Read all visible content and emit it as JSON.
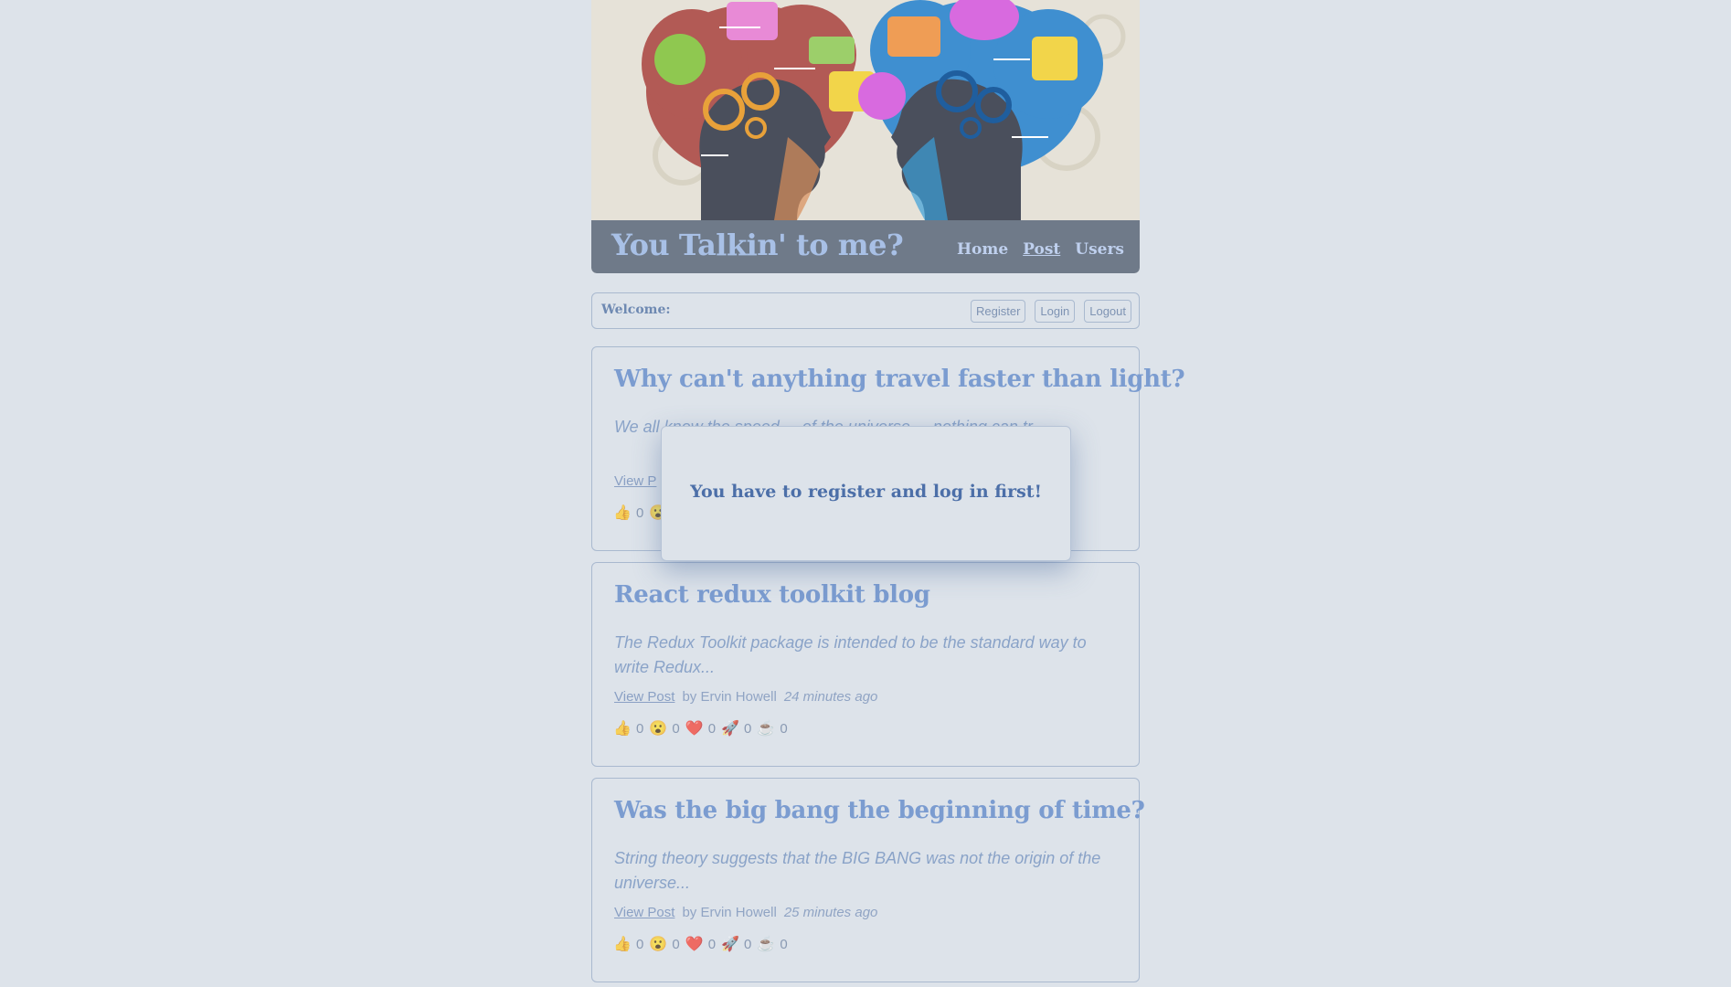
{
  "header": {
    "site_title": "You Talkin' to me?",
    "nav": [
      {
        "label": "Home",
        "active": false
      },
      {
        "label": "Post",
        "active": true
      },
      {
        "label": "Users",
        "active": false
      }
    ]
  },
  "welcome_bar": {
    "label": "Welcome:",
    "register_label": "Register",
    "login_label": "Login",
    "logout_label": "Logout"
  },
  "posts": [
    {
      "title": "Why can't anything travel faster than light?",
      "excerpt": "We all know the speed ... of the universe ... nothing can tr...",
      "view_label": "View P",
      "author": "",
      "time": "",
      "reactions": [
        "0"
      ]
    },
    {
      "title": "React redux toolkit blog",
      "excerpt": "The Redux Toolkit package is intended to be the standard way to write Redux...",
      "view_label": "View Post",
      "author": "by Ervin Howell",
      "time": "24 minutes ago",
      "reactions": [
        "0",
        "0",
        "0",
        "0",
        "0"
      ]
    },
    {
      "title": "Was the big bang the beginning of time?",
      "excerpt": "String theory suggests that the BIG BANG was not the origin of the universe...",
      "view_label": "View Post",
      "author": "by Ervin Howell",
      "time": "25 minutes ago",
      "reactions": [
        "0",
        "0",
        "0",
        "0",
        "0"
      ]
    }
  ],
  "reaction_icons": [
    "thumbs-up-icon",
    "surprised-face-icon",
    "heart-icon",
    "rocket-icon",
    "coffee-icon"
  ],
  "modal": {
    "message": "You have to register and log in first!"
  },
  "colors": {
    "background": "#dde3ea",
    "title_blue": "#7b9cd0",
    "modal_text": "#4c6fa8"
  }
}
